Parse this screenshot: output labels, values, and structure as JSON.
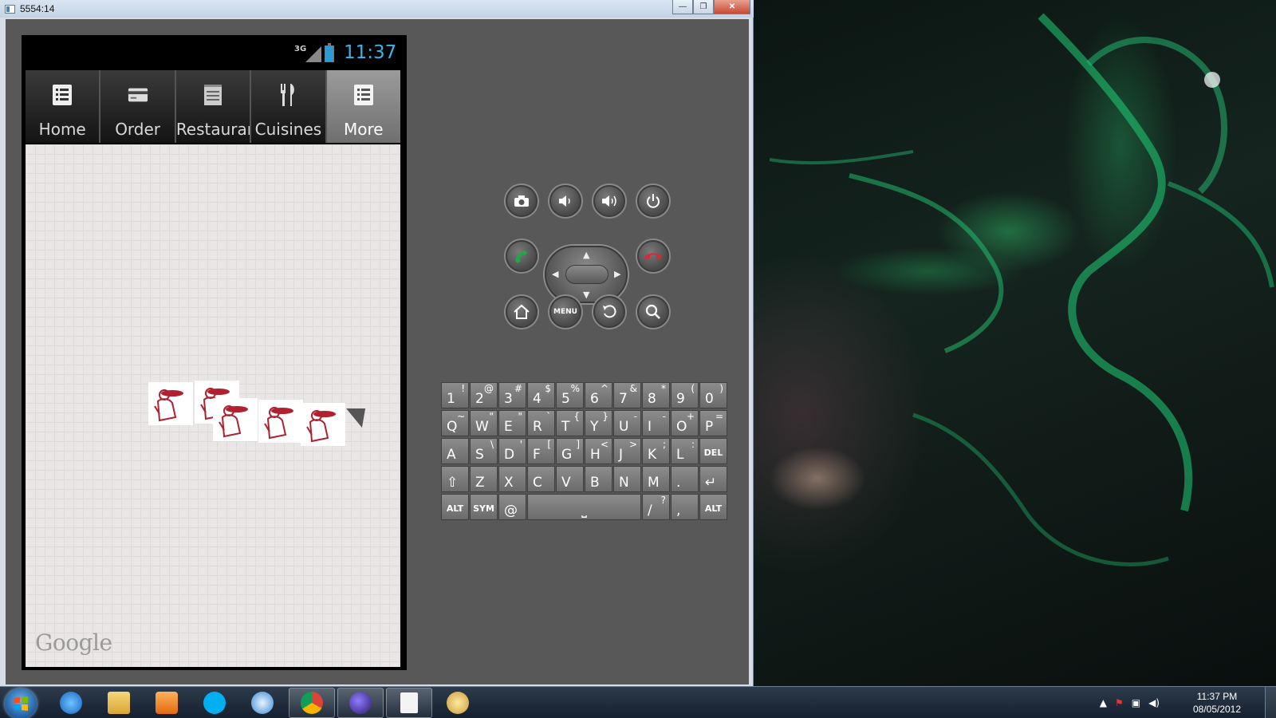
{
  "window": {
    "title": "5554:14",
    "minimize": "—",
    "maximize": "❐",
    "close": "✕"
  },
  "phone": {
    "network": "3G",
    "time": "11:37",
    "tabs": [
      {
        "label": "Home",
        "icon": "list-icon",
        "active": false
      },
      {
        "label": "Order",
        "icon": "card-icon",
        "active": false
      },
      {
        "label": "Restaurants",
        "icon": "notepad-icon",
        "active": false
      },
      {
        "label": "Cuisines",
        "icon": "fork-knife-icon",
        "active": false
      },
      {
        "label": "More",
        "icon": "list-icon",
        "active": true
      }
    ],
    "map_attribution": "Google",
    "marker_count": 5
  },
  "controls": {
    "camera": "camera-icon",
    "volume_down": "volume-down-icon",
    "volume_up": "volume-up-icon",
    "power": "power-icon",
    "call": "call-icon",
    "end_call": "end-call-icon",
    "home": "home-icon",
    "menu": "MENU",
    "back": "back-icon",
    "search": "search-icon"
  },
  "keyboard": {
    "row1": [
      [
        "1",
        "!"
      ],
      [
        "2",
        "@"
      ],
      [
        "3",
        "#"
      ],
      [
        "4",
        "$"
      ],
      [
        "5",
        "%"
      ],
      [
        "6",
        "^"
      ],
      [
        "7",
        "&"
      ],
      [
        "8",
        "*"
      ],
      [
        "9",
        "("
      ],
      [
        "0",
        ")"
      ]
    ],
    "row2": [
      [
        "Q",
        "~"
      ],
      [
        "W",
        "\""
      ],
      [
        "E",
        "\""
      ],
      [
        "R",
        "`"
      ],
      [
        "T",
        "{"
      ],
      [
        "Y",
        "}"
      ],
      [
        "U",
        "-"
      ],
      [
        "I",
        "-"
      ],
      [
        "O",
        "+"
      ],
      [
        "P",
        "="
      ]
    ],
    "row3": [
      [
        "A",
        ""
      ],
      [
        "S",
        "\\"
      ],
      [
        "D",
        "'"
      ],
      [
        "F",
        "["
      ],
      [
        "G",
        "]"
      ],
      [
        "H",
        "<"
      ],
      [
        "J",
        ">"
      ],
      [
        "K",
        ";"
      ],
      [
        "L",
        ":"
      ],
      [
        "DEL",
        ""
      ]
    ],
    "row4": [
      [
        "⇧",
        ""
      ],
      [
        "Z",
        ""
      ],
      [
        "X",
        ""
      ],
      [
        "C",
        ""
      ],
      [
        "V",
        ""
      ],
      [
        "B",
        ""
      ],
      [
        "N",
        ""
      ],
      [
        "M",
        ""
      ],
      [
        ".",
        ""
      ],
      [
        "↵",
        ""
      ]
    ],
    "row5": [
      [
        "ALT",
        ""
      ],
      [
        "SYM",
        ""
      ],
      [
        "@",
        ""
      ],
      [
        "⎵",
        ""
      ],
      [
        "/",
        "?"
      ],
      [
        ",",
        ""
      ],
      [
        "ALT",
        ""
      ]
    ]
  },
  "taskbar": {
    "clock_time": "11:37 PM",
    "clock_date": "08/05/2012"
  },
  "colors": {
    "tab_active": "#8a8a8a",
    "marker_red": "#b0202e",
    "time_blue": "#38b5e6"
  }
}
